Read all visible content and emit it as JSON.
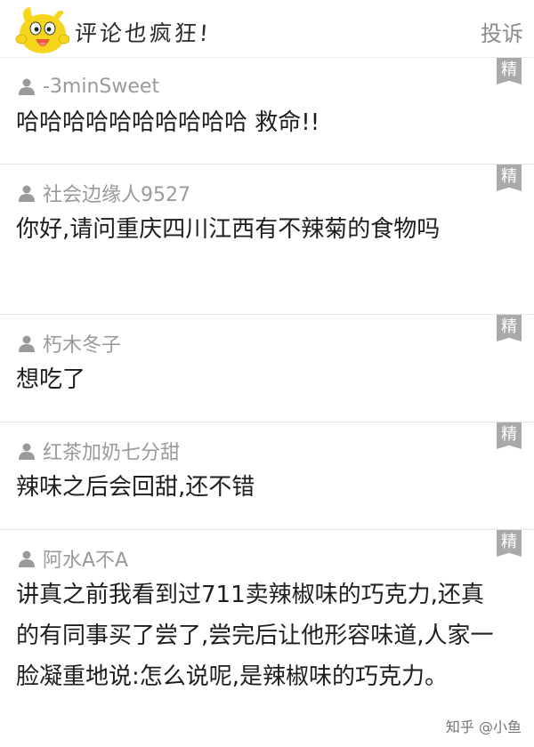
{
  "header": {
    "title": "评论也疯狂!",
    "report_label": "投诉",
    "mascot_icon": "yellow-chick-mascot-icon"
  },
  "badge_label": "精",
  "comments": [
    {
      "username": "-3minSweet",
      "text": "哈哈哈哈哈哈哈哈哈哈 救命!!"
    },
    {
      "username": "社会边缘人9527",
      "text": "你好,请问重庆四川江西有不辣菊的食物吗"
    },
    {
      "username": "朽木冬子",
      "text": "想吃了"
    },
    {
      "username": "红茶加奶七分甜",
      "text": "辣味之后会回甜,还不错"
    },
    {
      "username": "阿水A不A",
      "text": "讲真之前我看到过711卖辣椒味的巧克力,还真的有同事买了尝了,尝完后让他形容味道,人家一脸凝重地说:怎么说呢,是辣椒味的巧克力。"
    }
  ],
  "watermark": "知乎 @小鱼",
  "colors": {
    "badge": "#a9a9a9",
    "username": "#9a9a9a",
    "divider": "#e3e3e3",
    "mascot": "#f7d51d"
  }
}
